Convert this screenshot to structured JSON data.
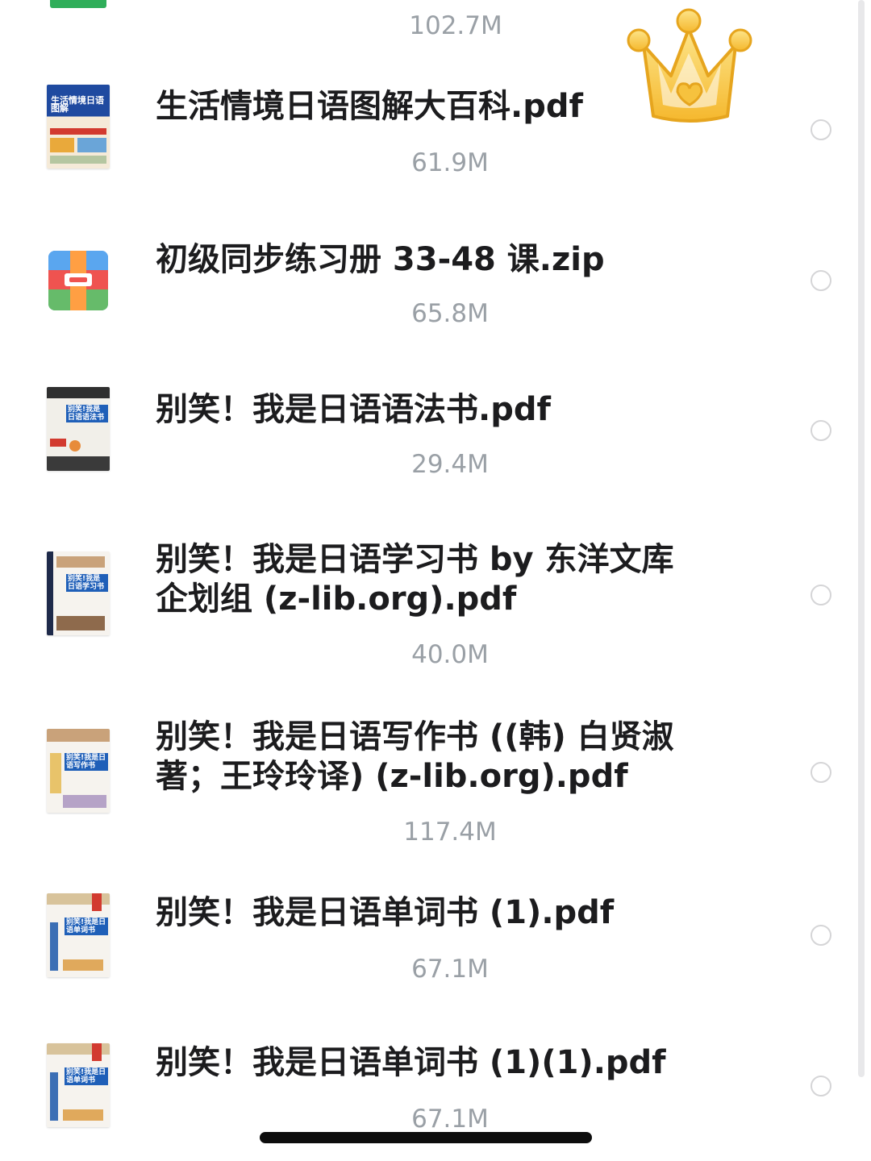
{
  "top_partial": {
    "size": "102.7M"
  },
  "files": [
    {
      "name": "生活情境日语图解大百科.pdf",
      "size": "61.9M",
      "icon": "book-cover-icon",
      "cover_title": "生活情境日语图解"
    },
    {
      "name": "初级同步练习册 33-48 课.zip",
      "size": "65.8M",
      "icon": "zip-archive-icon"
    },
    {
      "name": "别笑！我是日语语法书.pdf",
      "size": "29.4M",
      "icon": "book-cover-icon",
      "cover_title": "别笑!我是日语语法书"
    },
    {
      "name": "别笑！我是日语学习书 by 东洋文库企划组 (z-lib.org).pdf",
      "size": "40.0M",
      "icon": "book-cover-icon",
      "cover_title": "别笑!我是日语学习书"
    },
    {
      "name": "别笑！我是日语写作书 ((韩) 白贤淑著；王玲玲译) (z-lib.org).pdf",
      "size": "117.4M",
      "icon": "book-cover-icon",
      "cover_title": "别笑!我是日语写作书"
    },
    {
      "name": "别笑！我是日语单词书 (1).pdf",
      "size": "67.1M",
      "icon": "book-cover-icon",
      "cover_title": "别笑!我是日语单词书"
    },
    {
      "name": "别笑！我是日语单词书 (1)(1).pdf",
      "size": "67.1M",
      "icon": "book-cover-icon",
      "cover_title": "别笑!我是日语单词书"
    }
  ],
  "colors": {
    "title_text": "#1c1c1e",
    "size_text": "#9aa0a6",
    "radio_border": "#d5d5d7",
    "crown": "#f7c948"
  },
  "decorations": {
    "crown": "crown-sticker-icon"
  }
}
